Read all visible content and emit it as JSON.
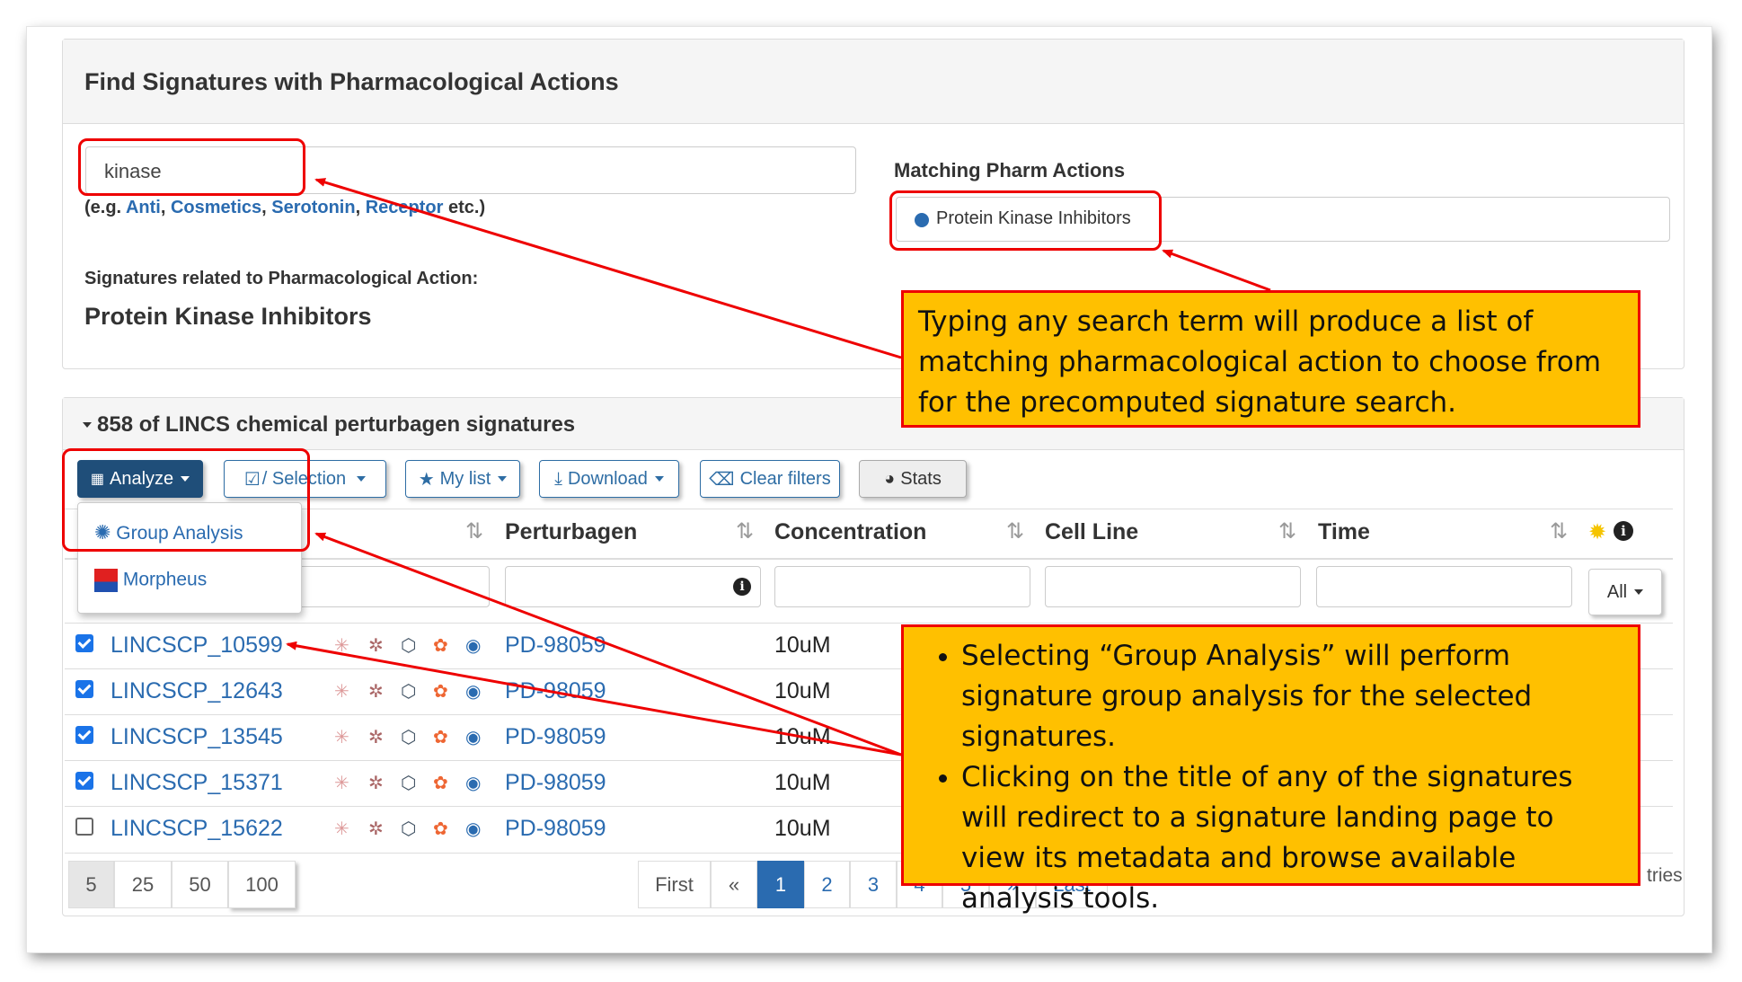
{
  "search_panel": {
    "title": "Find Signatures with Pharmacological Actions",
    "search_value": "kinase",
    "examples_prefix": "(e.g.",
    "examples": [
      "Anti",
      "Cosmetics",
      "Serotonin",
      "Receptor"
    ],
    "examples_suffix": "etc.)",
    "related_label": "Signatures related to Pharmacological Action:",
    "related_value": "Protein Kinase Inhibitors",
    "matching_label": "Matching Pharm Actions",
    "matching_item": "Protein Kinase Inhibitors"
  },
  "results_panel": {
    "title": "858 of LINCS chemical perturbagen signatures",
    "toolbar": {
      "analyze": "Analyze",
      "selection": "/ Selection",
      "my_list": "My list",
      "download": "Download",
      "clear_filters": "Clear filters",
      "stats": "Stats"
    },
    "analyze_menu": [
      "Group Analysis",
      "Morpheus"
    ],
    "columns": [
      "Perturbagen",
      "Concentration",
      "Cell Line",
      "Time"
    ],
    "time_filter": "All",
    "rows": [
      {
        "id": "LINCSCP_10599",
        "checked": true,
        "perturbagen": "PD-98059",
        "concentration": "10uM"
      },
      {
        "id": "LINCSCP_12643",
        "checked": true,
        "perturbagen": "PD-98059",
        "concentration": "10uM"
      },
      {
        "id": "LINCSCP_13545",
        "checked": true,
        "perturbagen": "PD-98059",
        "concentration": "10uM"
      },
      {
        "id": "LINCSCP_15371",
        "checked": true,
        "perturbagen": "PD-98059",
        "concentration": "10uM"
      },
      {
        "id": "LINCSCP_15622",
        "checked": false,
        "perturbagen": "PD-98059",
        "concentration": "10uM"
      }
    ],
    "page_sizes": [
      "5",
      "25",
      "50",
      "100"
    ],
    "pagination": [
      "First",
      "«",
      "1",
      "2",
      "3",
      "4",
      "5",
      "»",
      "Last"
    ],
    "entries_fragment": "tries"
  },
  "callouts": {
    "search": "Typing any search term will produce a list of matching pharmacological action to choose from for the precomputed signature search.",
    "bullets": [
      "Selecting “Group Analysis” will perform signature group analysis for the selected signatures.",
      "Clicking on the title of any of the signatures will redirect to a signature landing page to view its metadata and browse available analysis tools."
    ]
  },
  "colors": {
    "link": "#2a6bb0",
    "callout_bg": "#ffc000",
    "highlight": "#ee0000",
    "primary_btn": "#1f4e79"
  }
}
